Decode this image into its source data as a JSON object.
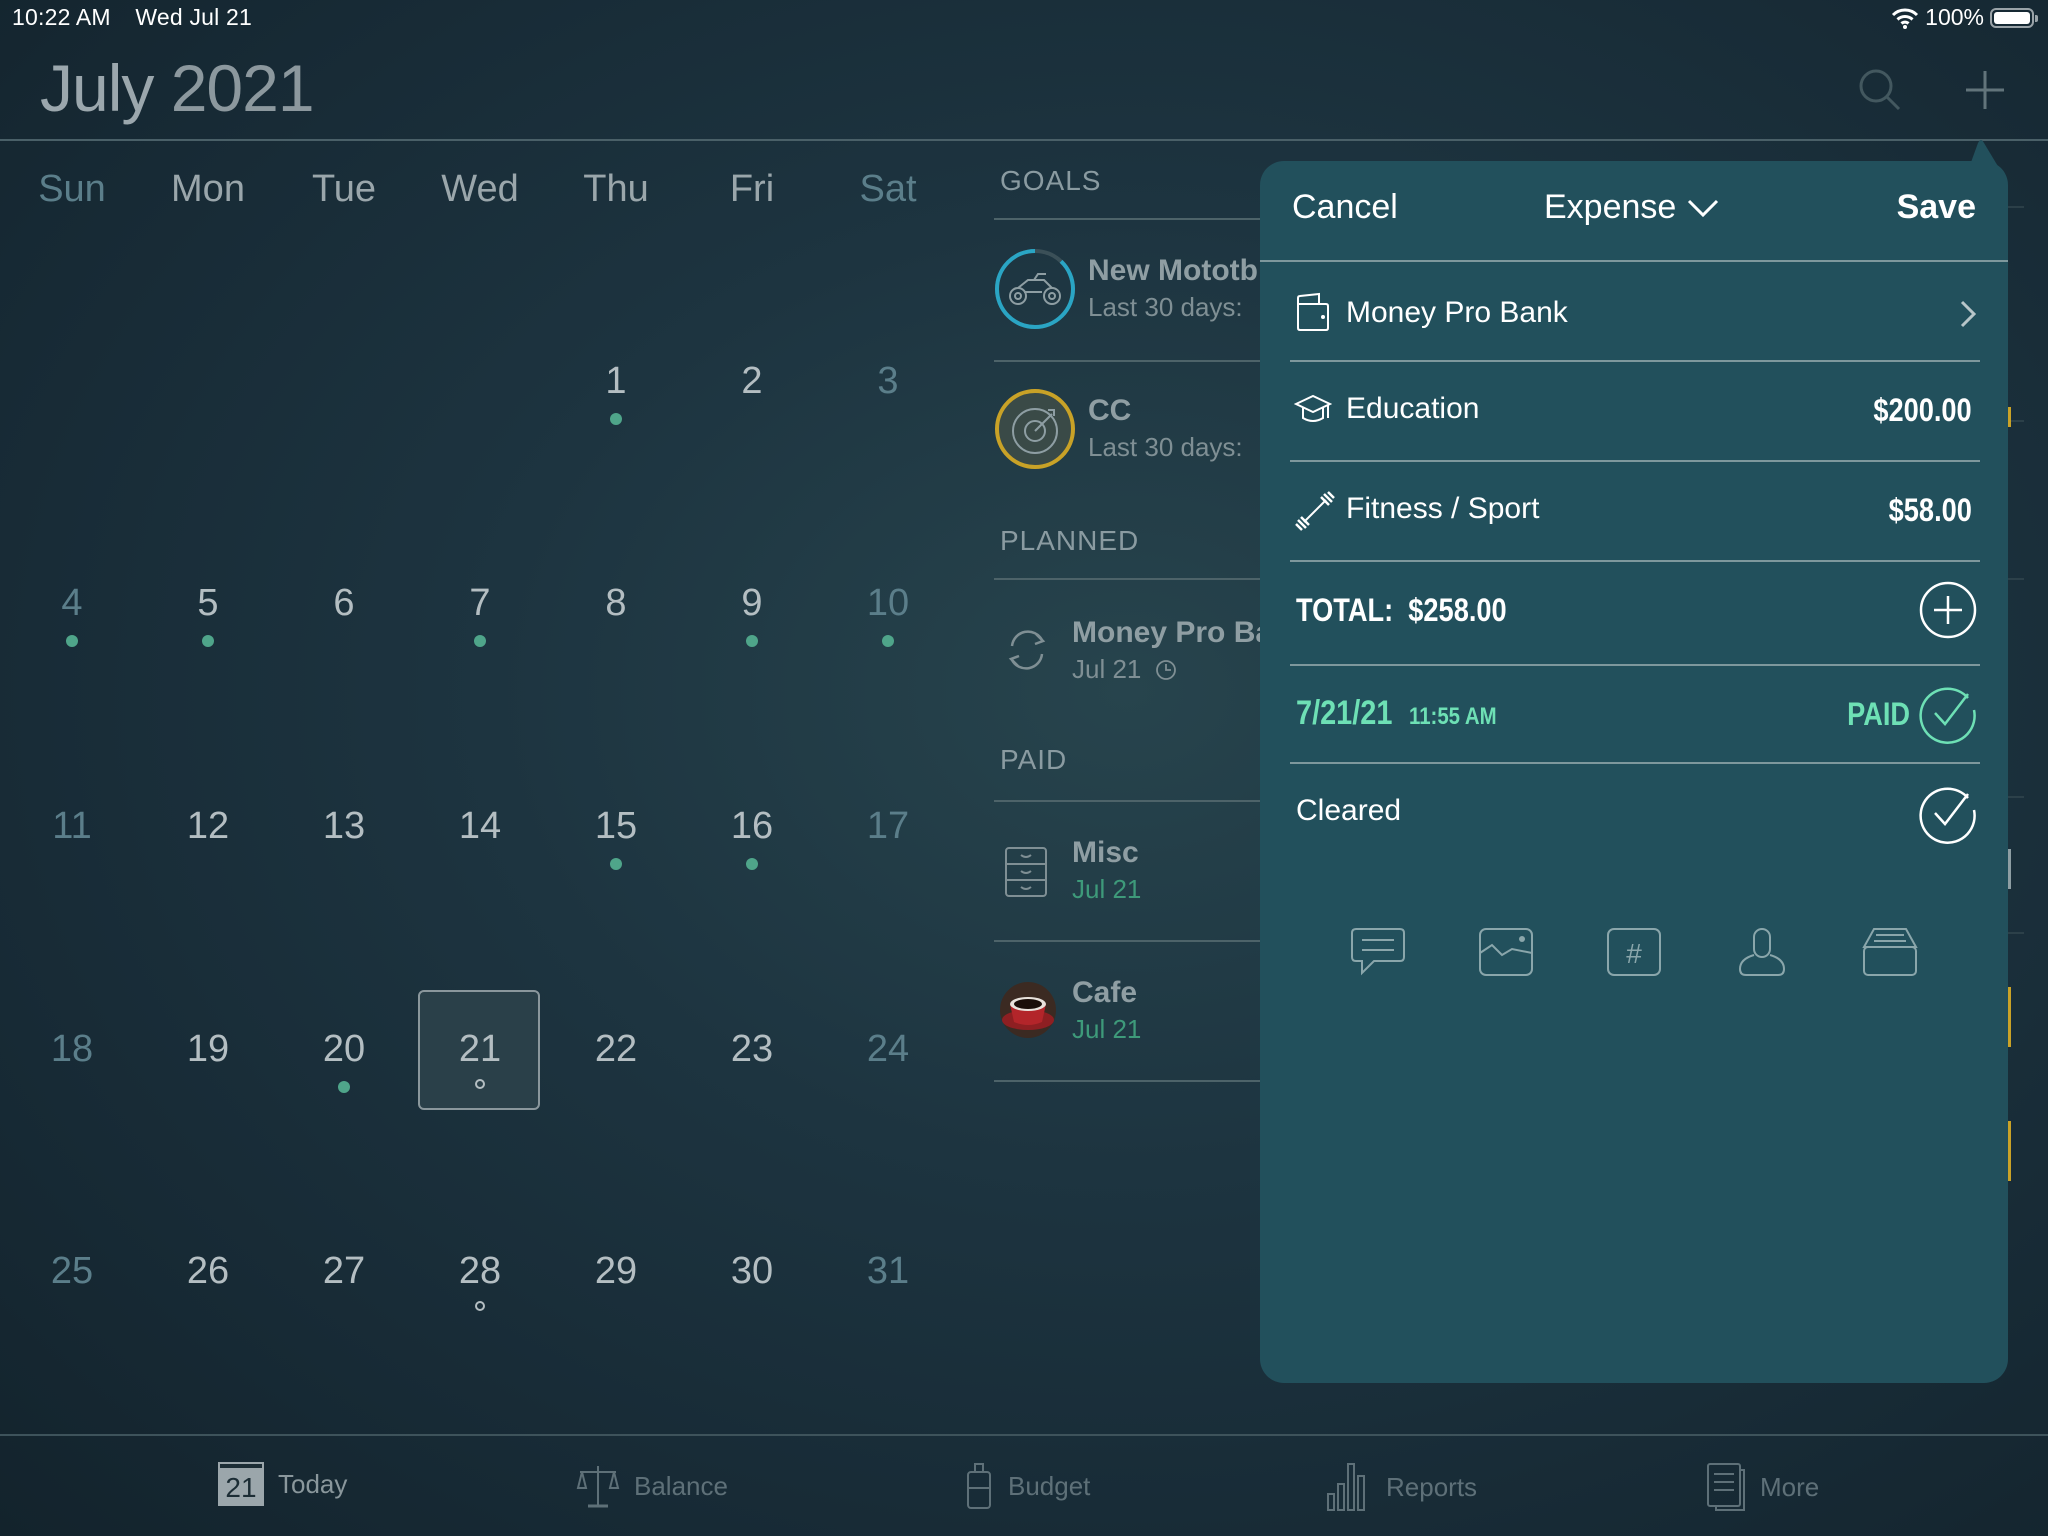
{
  "status_bar": {
    "time": "10:22 AM",
    "date": "Wed Jul 21",
    "battery": "100%",
    "wifi_icon": "wifi-icon",
    "battery_icon": "battery-icon"
  },
  "header": {
    "month": "July",
    "year": "2021",
    "search_icon": "search-icon",
    "add_icon": "plus-icon"
  },
  "calendar": {
    "weekdays": [
      "Sun",
      "Mon",
      "Tue",
      "Wed",
      "Thu",
      "Fri",
      "Sat"
    ],
    "weeks": [
      [
        {
          "d": ""
        },
        {
          "d": ""
        },
        {
          "d": ""
        },
        {
          "d": ""
        },
        {
          "d": "1",
          "m": "dot"
        },
        {
          "d": "2"
        },
        {
          "d": "3"
        }
      ],
      [
        {
          "d": "4",
          "m": "dot"
        },
        {
          "d": "5",
          "m": "dot"
        },
        {
          "d": "6"
        },
        {
          "d": "7",
          "m": "dot"
        },
        {
          "d": "8"
        },
        {
          "d": "9",
          "m": "dot"
        },
        {
          "d": "10",
          "m": "dot"
        }
      ],
      [
        {
          "d": "11"
        },
        {
          "d": "12"
        },
        {
          "d": "13"
        },
        {
          "d": "14"
        },
        {
          "d": "15",
          "m": "dot"
        },
        {
          "d": "16",
          "m": "dot"
        },
        {
          "d": "17"
        }
      ],
      [
        {
          "d": "18"
        },
        {
          "d": "19"
        },
        {
          "d": "20",
          "m": "dot"
        },
        {
          "d": "21",
          "m": "ring",
          "today": true
        },
        {
          "d": "22"
        },
        {
          "d": "23"
        },
        {
          "d": "24"
        }
      ],
      [
        {
          "d": "25"
        },
        {
          "d": "26"
        },
        {
          "d": "27"
        },
        {
          "d": "28",
          "m": "ring"
        },
        {
          "d": "29"
        },
        {
          "d": "30"
        },
        {
          "d": "31"
        }
      ]
    ],
    "selected_day": "21"
  },
  "side_list": {
    "goals_label": "GOALS",
    "goals": [
      {
        "title": "New Mototb",
        "subtitle": "Last 30 days: ",
        "icon": "motorcycle-icon",
        "ring_color": "#2aa5c4",
        "progress": 0.88
      },
      {
        "title": "CC",
        "subtitle": "Last 30 days: ",
        "icon": "target-icon",
        "ring_color": "#c9a227",
        "progress": 1.0
      }
    ],
    "planned_label": "PLANNED",
    "planned": [
      {
        "title": "Money Pro Ba",
        "subtitle": "Jul 21",
        "icon": "repeat-icon"
      }
    ],
    "paid_label": "PAID",
    "paid": [
      {
        "title": "Misc",
        "subtitle": "Jul 21",
        "icon": "cabinet-icon"
      },
      {
        "title": "Cafe",
        "subtitle": "Jul 21",
        "icon": "coffee-cup-icon"
      }
    ]
  },
  "popover": {
    "cancel": "Cancel",
    "type": "Expense",
    "save": "Save",
    "account": "Money Pro Bank",
    "categories": [
      {
        "name": "Education",
        "amount": "$200.00",
        "icon": "graduation-cap-icon"
      },
      {
        "name": "Fitness / Sport",
        "amount": "$58.00",
        "icon": "dumbbell-icon"
      }
    ],
    "total_label": "TOTAL:",
    "total_value": "$258.00",
    "date": "7/21/21",
    "time": "11:55 AM",
    "paid_label": "PAID",
    "cleared_label": "Cleared",
    "accent": "#6ee0b5",
    "tools": [
      "comment-icon",
      "photo-icon",
      "hashtag-icon",
      "payee-icon",
      "archive-icon"
    ]
  },
  "tabbar": {
    "items": [
      {
        "label": "Today",
        "icon": "calendar-icon",
        "badge": "21",
        "active": true
      },
      {
        "label": "Balance",
        "icon": "scales-icon"
      },
      {
        "label": "Budget",
        "icon": "jar-icon"
      },
      {
        "label": "Reports",
        "icon": "bar-chart-icon"
      },
      {
        "label": "More",
        "icon": "document-icon"
      }
    ]
  }
}
